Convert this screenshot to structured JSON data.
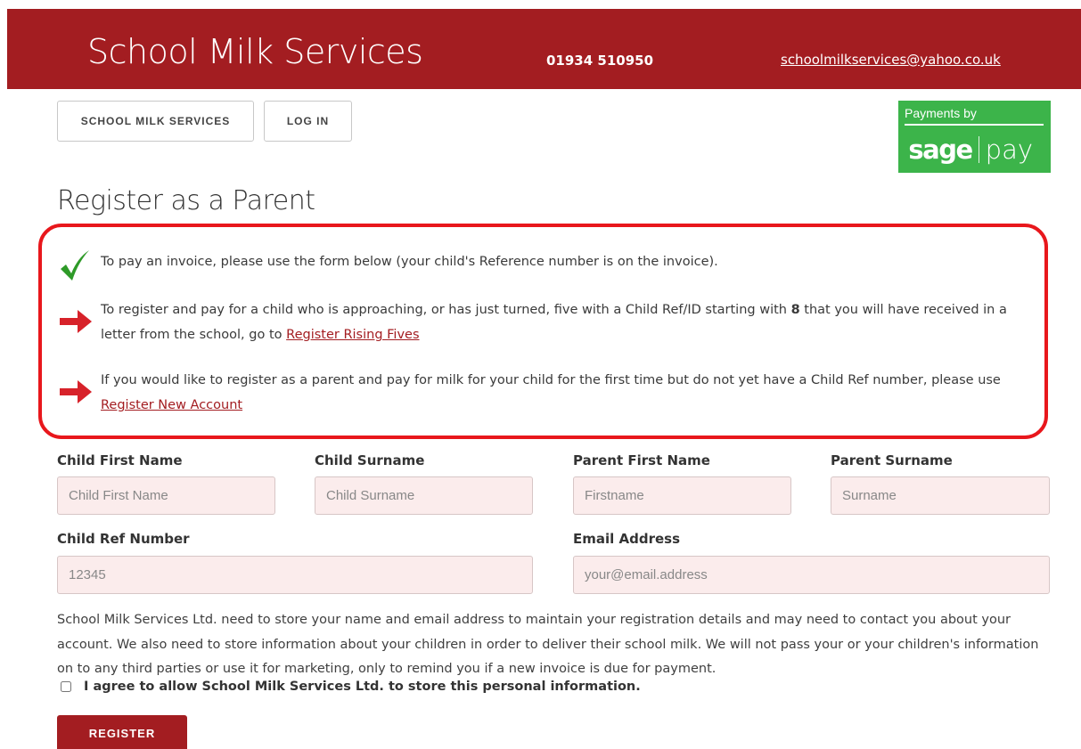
{
  "colors": {
    "brand": "#a31d21",
    "sagepay": "#3cb44a",
    "annotation": "#e8171c",
    "check": "#2e9a28",
    "arrow": "#d7222a"
  },
  "header": {
    "title": "School Milk Services",
    "phone": "01934 510950",
    "email": "schoolmilkservices@yahoo.co.uk"
  },
  "nav": {
    "home_label": "SCHOOL MILK SERVICES",
    "login_label": "LOG IN"
  },
  "sagepay": {
    "top_text": "Payments by",
    "logo_sage": "sage",
    "logo_pay": "pay"
  },
  "page_title": "Register as a Parent",
  "notices": [
    {
      "icon": "checkmark-icon",
      "text": "To pay an invoice, please use the form below (your child's Reference number is on the invoice)."
    },
    {
      "icon": "arrow-right-icon",
      "text_before": "To register and pay for a child who is approaching, or has just turned, five with a Child Ref/ID starting with ",
      "bold": "8",
      "text_middle": " that you will have received in a letter from the school, go to ",
      "link": "Register Rising Fives"
    },
    {
      "icon": "arrow-right-icon",
      "text_before": "If you would like to register as a parent and pay for milk for your child for the first time but do not yet have a Child Ref number, please use ",
      "link": "Register New Account"
    }
  ],
  "form": {
    "child_first_name": {
      "label": "Child First Name",
      "placeholder": "Child First Name",
      "value": ""
    },
    "child_surname": {
      "label": "Child Surname",
      "placeholder": "Child Surname",
      "value": ""
    },
    "parent_first_name": {
      "label": "Parent First Name",
      "placeholder": "Firstname",
      "value": ""
    },
    "parent_surname": {
      "label": "Parent Surname",
      "placeholder": "Surname",
      "value": ""
    },
    "child_ref": {
      "label": "Child Ref Number",
      "placeholder": "12345",
      "value": ""
    },
    "email": {
      "label": "Email Address",
      "placeholder": "your@email.address",
      "value": ""
    }
  },
  "consent_text": "School Milk Services Ltd. need to store your name and email address to maintain your registration details and may need to contact you about your account. We also need to store information about your children in order to deliver their school milk. We will not pass your or your children's information on to any third parties or use it for marketing, only to remind you if a new invoice is due for payment.",
  "agree_label": "I agree to allow School Milk Services Ltd. to store this personal information.",
  "agree_checked": false,
  "register_label": "REGISTER"
}
